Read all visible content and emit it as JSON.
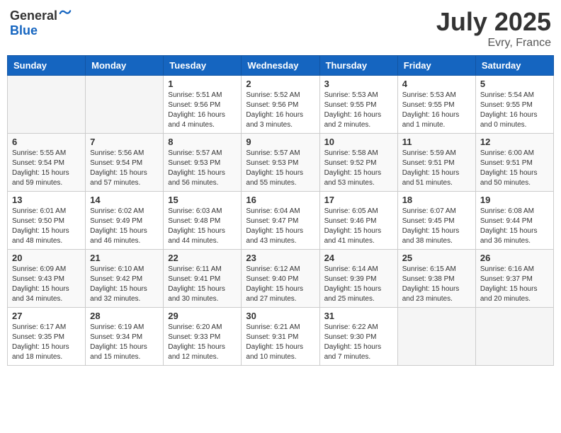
{
  "header": {
    "logo_general": "General",
    "logo_blue": "Blue",
    "month": "July 2025",
    "location": "Evry, France"
  },
  "weekdays": [
    "Sunday",
    "Monday",
    "Tuesday",
    "Wednesday",
    "Thursday",
    "Friday",
    "Saturday"
  ],
  "weeks": [
    [
      {
        "day": "",
        "info": ""
      },
      {
        "day": "",
        "info": ""
      },
      {
        "day": "1",
        "info": "Sunrise: 5:51 AM\nSunset: 9:56 PM\nDaylight: 16 hours and 4 minutes."
      },
      {
        "day": "2",
        "info": "Sunrise: 5:52 AM\nSunset: 9:56 PM\nDaylight: 16 hours and 3 minutes."
      },
      {
        "day": "3",
        "info": "Sunrise: 5:53 AM\nSunset: 9:55 PM\nDaylight: 16 hours and 2 minutes."
      },
      {
        "day": "4",
        "info": "Sunrise: 5:53 AM\nSunset: 9:55 PM\nDaylight: 16 hours and 1 minute."
      },
      {
        "day": "5",
        "info": "Sunrise: 5:54 AM\nSunset: 9:55 PM\nDaylight: 16 hours and 0 minutes."
      }
    ],
    [
      {
        "day": "6",
        "info": "Sunrise: 5:55 AM\nSunset: 9:54 PM\nDaylight: 15 hours and 59 minutes."
      },
      {
        "day": "7",
        "info": "Sunrise: 5:56 AM\nSunset: 9:54 PM\nDaylight: 15 hours and 57 minutes."
      },
      {
        "day": "8",
        "info": "Sunrise: 5:57 AM\nSunset: 9:53 PM\nDaylight: 15 hours and 56 minutes."
      },
      {
        "day": "9",
        "info": "Sunrise: 5:57 AM\nSunset: 9:53 PM\nDaylight: 15 hours and 55 minutes."
      },
      {
        "day": "10",
        "info": "Sunrise: 5:58 AM\nSunset: 9:52 PM\nDaylight: 15 hours and 53 minutes."
      },
      {
        "day": "11",
        "info": "Sunrise: 5:59 AM\nSunset: 9:51 PM\nDaylight: 15 hours and 51 minutes."
      },
      {
        "day": "12",
        "info": "Sunrise: 6:00 AM\nSunset: 9:51 PM\nDaylight: 15 hours and 50 minutes."
      }
    ],
    [
      {
        "day": "13",
        "info": "Sunrise: 6:01 AM\nSunset: 9:50 PM\nDaylight: 15 hours and 48 minutes."
      },
      {
        "day": "14",
        "info": "Sunrise: 6:02 AM\nSunset: 9:49 PM\nDaylight: 15 hours and 46 minutes."
      },
      {
        "day": "15",
        "info": "Sunrise: 6:03 AM\nSunset: 9:48 PM\nDaylight: 15 hours and 44 minutes."
      },
      {
        "day": "16",
        "info": "Sunrise: 6:04 AM\nSunset: 9:47 PM\nDaylight: 15 hours and 43 minutes."
      },
      {
        "day": "17",
        "info": "Sunrise: 6:05 AM\nSunset: 9:46 PM\nDaylight: 15 hours and 41 minutes."
      },
      {
        "day": "18",
        "info": "Sunrise: 6:07 AM\nSunset: 9:45 PM\nDaylight: 15 hours and 38 minutes."
      },
      {
        "day": "19",
        "info": "Sunrise: 6:08 AM\nSunset: 9:44 PM\nDaylight: 15 hours and 36 minutes."
      }
    ],
    [
      {
        "day": "20",
        "info": "Sunrise: 6:09 AM\nSunset: 9:43 PM\nDaylight: 15 hours and 34 minutes."
      },
      {
        "day": "21",
        "info": "Sunrise: 6:10 AM\nSunset: 9:42 PM\nDaylight: 15 hours and 32 minutes."
      },
      {
        "day": "22",
        "info": "Sunrise: 6:11 AM\nSunset: 9:41 PM\nDaylight: 15 hours and 30 minutes."
      },
      {
        "day": "23",
        "info": "Sunrise: 6:12 AM\nSunset: 9:40 PM\nDaylight: 15 hours and 27 minutes."
      },
      {
        "day": "24",
        "info": "Sunrise: 6:14 AM\nSunset: 9:39 PM\nDaylight: 15 hours and 25 minutes."
      },
      {
        "day": "25",
        "info": "Sunrise: 6:15 AM\nSunset: 9:38 PM\nDaylight: 15 hours and 23 minutes."
      },
      {
        "day": "26",
        "info": "Sunrise: 6:16 AM\nSunset: 9:37 PM\nDaylight: 15 hours and 20 minutes."
      }
    ],
    [
      {
        "day": "27",
        "info": "Sunrise: 6:17 AM\nSunset: 9:35 PM\nDaylight: 15 hours and 18 minutes."
      },
      {
        "day": "28",
        "info": "Sunrise: 6:19 AM\nSunset: 9:34 PM\nDaylight: 15 hours and 15 minutes."
      },
      {
        "day": "29",
        "info": "Sunrise: 6:20 AM\nSunset: 9:33 PM\nDaylight: 15 hours and 12 minutes."
      },
      {
        "day": "30",
        "info": "Sunrise: 6:21 AM\nSunset: 9:31 PM\nDaylight: 15 hours and 10 minutes."
      },
      {
        "day": "31",
        "info": "Sunrise: 6:22 AM\nSunset: 9:30 PM\nDaylight: 15 hours and 7 minutes."
      },
      {
        "day": "",
        "info": ""
      },
      {
        "day": "",
        "info": ""
      }
    ]
  ]
}
